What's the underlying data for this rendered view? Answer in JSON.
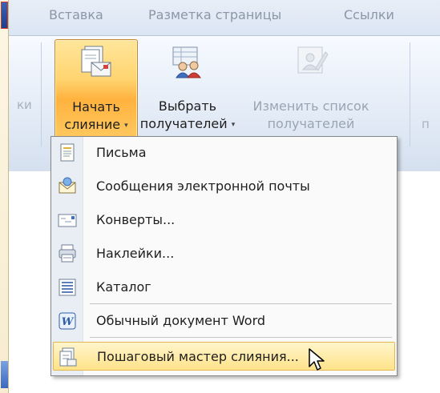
{
  "tabs": [
    {
      "label": "Вставка"
    },
    {
      "label": "Разметка страницы"
    },
    {
      "label": "Ссылки"
    }
  ],
  "ribbon": {
    "left_partial": "ки",
    "right_partial": "п",
    "buttons": [
      {
        "line1": "Начать",
        "line2": "слияние",
        "dropdown": "▾",
        "state": "active",
        "icon": "mail-merge-start-icon"
      },
      {
        "line1": "Выбрать",
        "line2": "получателей",
        "dropdown": "▾",
        "state": "normal",
        "icon": "select-recipients-icon"
      },
      {
        "line1": "Изменить список",
        "line2": "получателей",
        "dropdown": "",
        "state": "disabled",
        "icon": "edit-recipient-list-icon"
      }
    ]
  },
  "menu": {
    "items": [
      {
        "label": "Письма",
        "icon": "letter-icon"
      },
      {
        "label": "Сообщения электронной почты",
        "icon": "email-message-icon"
      },
      {
        "label": "Конверты...",
        "icon": "envelope-icon"
      },
      {
        "label": "Наклейки...",
        "icon": "labels-icon"
      },
      {
        "label": "Каталог",
        "icon": "directory-icon"
      },
      {
        "label": "Обычный документ Word",
        "icon": "word-document-icon"
      },
      {
        "label": "Пошаговый мастер слияния...",
        "icon": "mail-merge-wizard-icon",
        "highlighted": true
      }
    ]
  },
  "colors": {
    "active_button": "#ffc960",
    "menu_highlight": "#ffe38a",
    "ribbon_bg": "#e4ecf7"
  }
}
